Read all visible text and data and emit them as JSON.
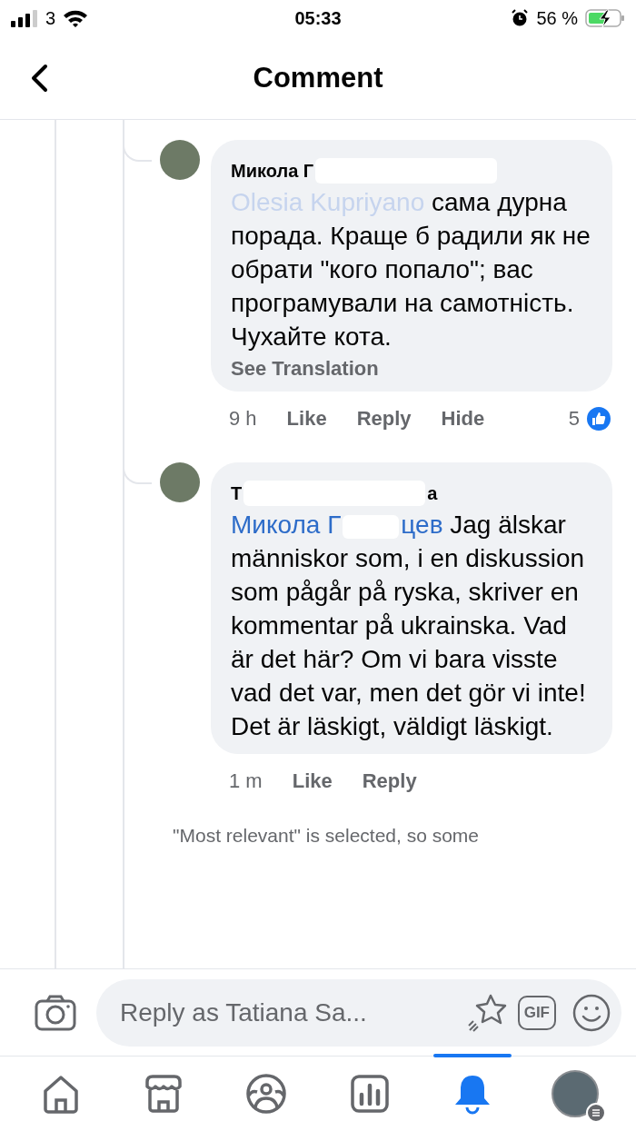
{
  "status_bar": {
    "carrier": "3",
    "time": "05:33",
    "battery": "56 %"
  },
  "header": {
    "title": "Comment"
  },
  "comments": [
    {
      "author": "Микола Г",
      "mention": "Olesia Kupriyano",
      "mention_faded": true,
      "text": "сама дурна порада. Краще б радили як не обрати \"кого попало\"; вас програмували на самотність. Чухайте кота.",
      "translate": "See Translation",
      "time": "9 h",
      "actions": [
        "Like",
        "Reply",
        "Hide"
      ],
      "reactions": "5"
    },
    {
      "author": "Т",
      "author_tail": "а",
      "mention": "Микола Г",
      "mention_tail": "цев",
      "mention_faded": false,
      "text": "Jag älskar människor som, i en diskussion som pågår på ryska, skriver en kommentar på ukrainska. Vad är det här? Om vi bara visste vad det var, men det gör vi inte! Det är läskigt, väldigt läskigt.",
      "time": "1 m",
      "actions": [
        "Like",
        "Reply"
      ]
    }
  ],
  "notice": "\"Most relevant\" is selected, so some",
  "composer": {
    "placeholder": "Reply as Tatiana Sa...",
    "gif": "GIF"
  },
  "nav": [
    {
      "kind": "home",
      "selected": false
    },
    {
      "kind": "marketplace",
      "selected": false
    },
    {
      "kind": "groups",
      "selected": false
    },
    {
      "kind": "feeds",
      "selected": false
    },
    {
      "kind": "notifications",
      "selected": true
    },
    {
      "kind": "profile",
      "selected": false
    }
  ]
}
